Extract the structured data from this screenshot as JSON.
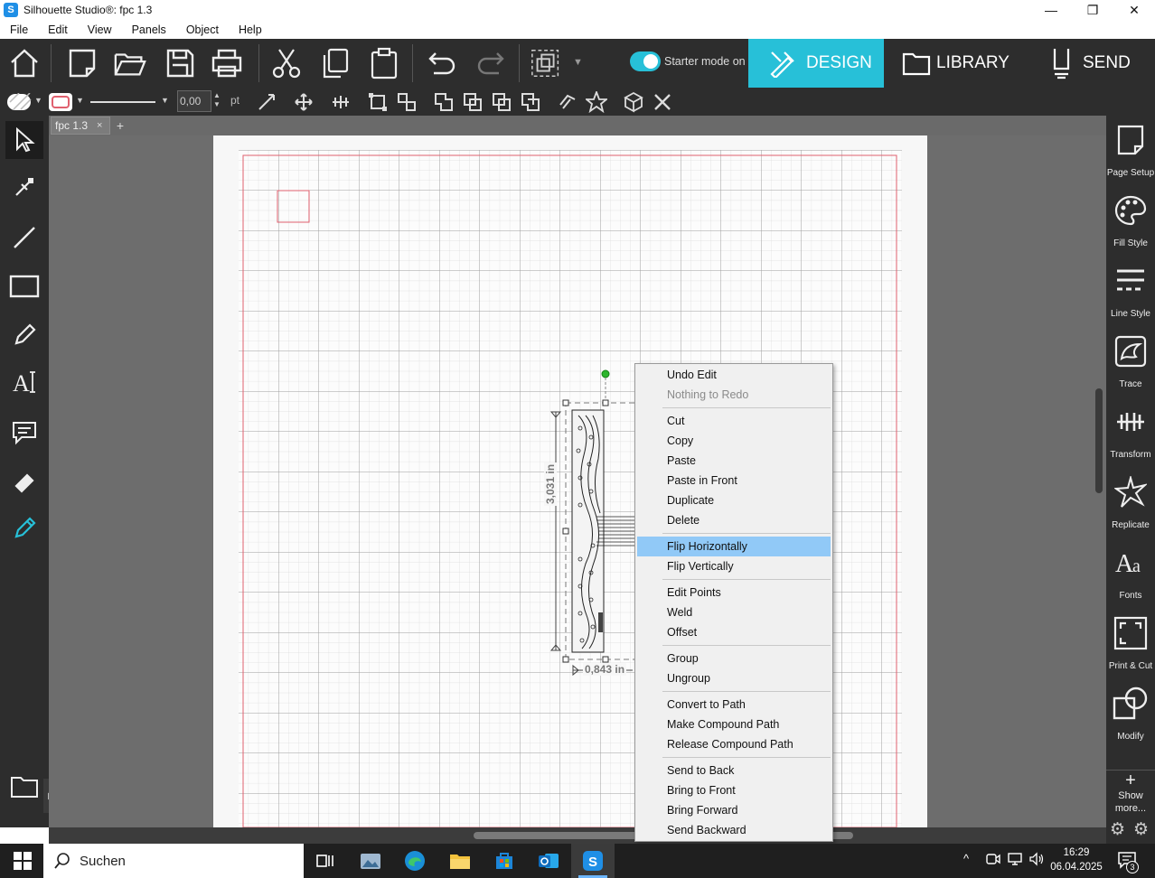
{
  "window": {
    "title": "Silhouette Studio®: fpc 1.3",
    "app_icon": "S",
    "controls": [
      "—",
      "❐",
      "✕"
    ]
  },
  "menubar": {
    "items": [
      "File",
      "Edit",
      "View",
      "Panels",
      "Object",
      "Help"
    ]
  },
  "main_toolbar": {
    "starter_mode_label": "Starter mode on",
    "tabs": [
      {
        "label": "DESIGN",
        "active": true
      },
      {
        "label": "LIBRARY",
        "active": false
      },
      {
        "label": "SEND",
        "active": false
      }
    ]
  },
  "sub_toolbar": {
    "line_width_value": "0,00",
    "line_width_unit": "pt"
  },
  "document": {
    "tab_label": "fpc 1.3",
    "tab_close": "×",
    "add_tab": "+",
    "height_dimension": "3,031 in",
    "width_dimension": "0,843 in"
  },
  "right_panel": {
    "items": [
      {
        "label": "Page Setup",
        "icon": "page-setup-icon"
      },
      {
        "label": "Fill Style",
        "icon": "palette-icon"
      },
      {
        "label": "Line Style",
        "icon": "line-style-icon"
      },
      {
        "label": "Trace",
        "icon": "trace-icon"
      },
      {
        "label": "Transform",
        "icon": "transform-icon"
      },
      {
        "label": "Replicate",
        "icon": "replicate-icon"
      },
      {
        "label": "Fonts",
        "icon": "fonts-icon"
      },
      {
        "label": "Print & Cut",
        "icon": "print-cut-icon"
      },
      {
        "label": "Modify",
        "icon": "modify-icon"
      }
    ],
    "show_more_line1": "Show",
    "show_more_line2": "more..."
  },
  "context_menu": {
    "items": [
      {
        "label": "Undo Edit"
      },
      {
        "label": "Nothing to Redo",
        "disabled": true
      },
      {
        "label": "Cut"
      },
      {
        "label": "Copy"
      },
      {
        "label": "Paste"
      },
      {
        "label": "Paste in Front"
      },
      {
        "label": "Duplicate"
      },
      {
        "label": "Delete"
      },
      {
        "label": "Flip Horizontally",
        "highlighted": true
      },
      {
        "label": "Flip Vertically"
      },
      {
        "label": "Edit Points"
      },
      {
        "label": "Weld"
      },
      {
        "label": "Offset"
      },
      {
        "label": "Group"
      },
      {
        "label": "Ungroup"
      },
      {
        "label": "Convert to Path"
      },
      {
        "label": "Make Compound Path"
      },
      {
        "label": "Release Compound Path"
      },
      {
        "label": "Send to Back"
      },
      {
        "label": "Bring to Front"
      },
      {
        "label": "Bring Forward"
      },
      {
        "label": "Send Backward"
      }
    ]
  },
  "taskbar": {
    "search_label": "Suchen",
    "time": "16:29",
    "date": "06.04.2025",
    "notification_count": "3"
  },
  "colors": {
    "accent": "#27c0d8",
    "toolbar_bg": "#2d2d2d",
    "menu_highlight": "#91c9f7",
    "cut_line": "#e0606e"
  }
}
